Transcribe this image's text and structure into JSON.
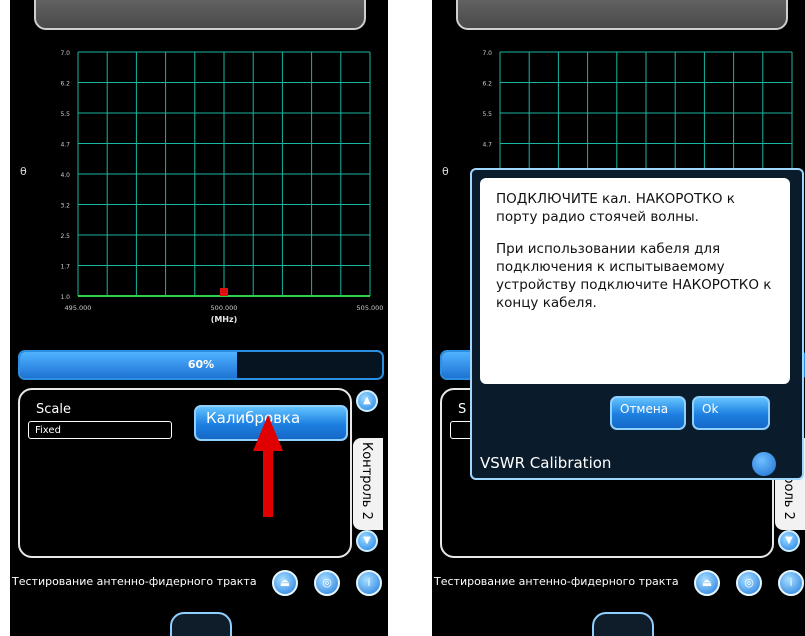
{
  "left": {
    "chart_data": {
      "type": "line",
      "y_ticks": [
        "7.0",
        "6.2",
        "5.5",
        "4.7",
        "4.0",
        "3.2",
        "2.5",
        "1.7",
        "1.0"
      ],
      "x_ticks": [
        "495.000",
        "500.000",
        "505.000"
      ],
      "xlabel": "(MHz)",
      "ylim": [
        1.0,
        7.0
      ],
      "xlim": [
        495.0,
        505.0
      ],
      "grid": true,
      "series": [
        {
          "x": [
            495.0,
            505.0
          ],
          "y": [
            1.0,
            1.0
          ]
        }
      ],
      "marker": {
        "x": 500.0,
        "y": 1.0
      }
    },
    "side_glyph": "θ",
    "progress": {
      "value": 0.6,
      "label": "60%"
    },
    "scale_label": "Scale",
    "scale_value": "Fixed",
    "calibrate_label": "Калибровка",
    "side_tab_label": "Контроль 2",
    "bottom_title": "Тестирование антенно-фидерного тракта",
    "colors": {
      "grid": "#18b5a0",
      "trace": "#2fd14a",
      "marker": "#e01010",
      "accent": "#1f7fe0"
    }
  },
  "right": {
    "chart_data": {
      "type": "line",
      "y_ticks": [
        "7.0",
        "6.2",
        "5.5",
        "4.7"
      ],
      "ylim": [
        1.0,
        7.0
      ],
      "grid": true
    },
    "side_glyph": "θ",
    "scale_partial": "S",
    "side_tab_label": "Контроль 2",
    "bottom_title": "Тестирование антенно-фидерного тракта",
    "dialog": {
      "message_1": "ПОДКЛЮЧИТЕ кал. НАКОРОТКО к порту радио стоячей волны.",
      "message_2": "При использовании кабеля для подключения к испытываемому устройству подключите НАКОРОТКО к концу кабеля.",
      "cancel_label": "Отмена",
      "ok_label": "Ok",
      "title": "VSWR Calibration"
    }
  }
}
